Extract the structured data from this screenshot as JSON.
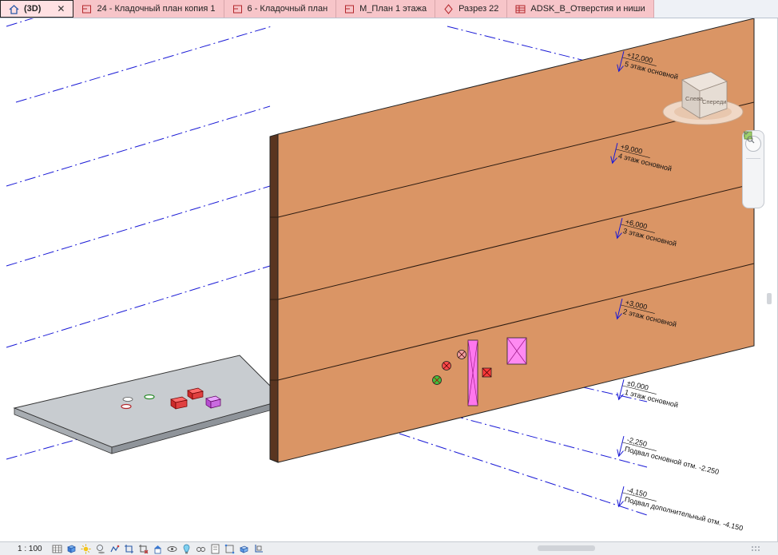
{
  "tabs": [
    {
      "label": "(3D)",
      "icon": "home-icon",
      "active": true
    },
    {
      "label": "24 - Кладочный план копия 1",
      "icon": "floor-plan-icon"
    },
    {
      "label": "6 - Кладочный план",
      "icon": "floor-plan-icon"
    },
    {
      "label": "М_План 1 этажа",
      "icon": "floor-plan-icon"
    },
    {
      "label": "Разрез 22",
      "icon": "section-icon"
    },
    {
      "label": "ADSK_B_Отверстия и ниши",
      "icon": "schedule-icon"
    }
  ],
  "view_cube": {
    "left_face": "Слева",
    "front_face": "Спереди"
  },
  "levels": [
    {
      "elevation": "+12,000",
      "name": "5 этаж основной"
    },
    {
      "elevation": "+9,000",
      "name": "4 этаж основной"
    },
    {
      "elevation": "+6,000",
      "name": "3 этаж основной"
    },
    {
      "elevation": "+3,000",
      "name": "2 этаж основной"
    },
    {
      "elevation": "±0,000",
      "name": "1 этаж основной"
    },
    {
      "elevation": "-2,250",
      "name": "Подвал основной отм. -2.250"
    },
    {
      "elevation": "-4,150",
      "name": "Подвал дополнительный отм. -4.150"
    }
  ],
  "view_control_bar": {
    "scale": "1 : 100",
    "icons": [
      "detail-level-icon",
      "visual-style-icon",
      "sun-path-icon",
      "shadows-icon",
      "render-icon",
      "crop-view-icon",
      "show-crop-icon",
      "unlock-3d-icon",
      "temporary-hide-icon",
      "reveal-hidden-icon",
      "worksharing-icon",
      "design-options-icon",
      "analytical-model-icon",
      "highlight-displacement-icon",
      "reveal-constraints-icon"
    ]
  },
  "colors": {
    "tab_background": "#f7c5c9",
    "wall_front": "#da9565",
    "wall_side": "#5a3520",
    "level_line": "#1a1ad6",
    "slab": "#c8ccd0"
  }
}
